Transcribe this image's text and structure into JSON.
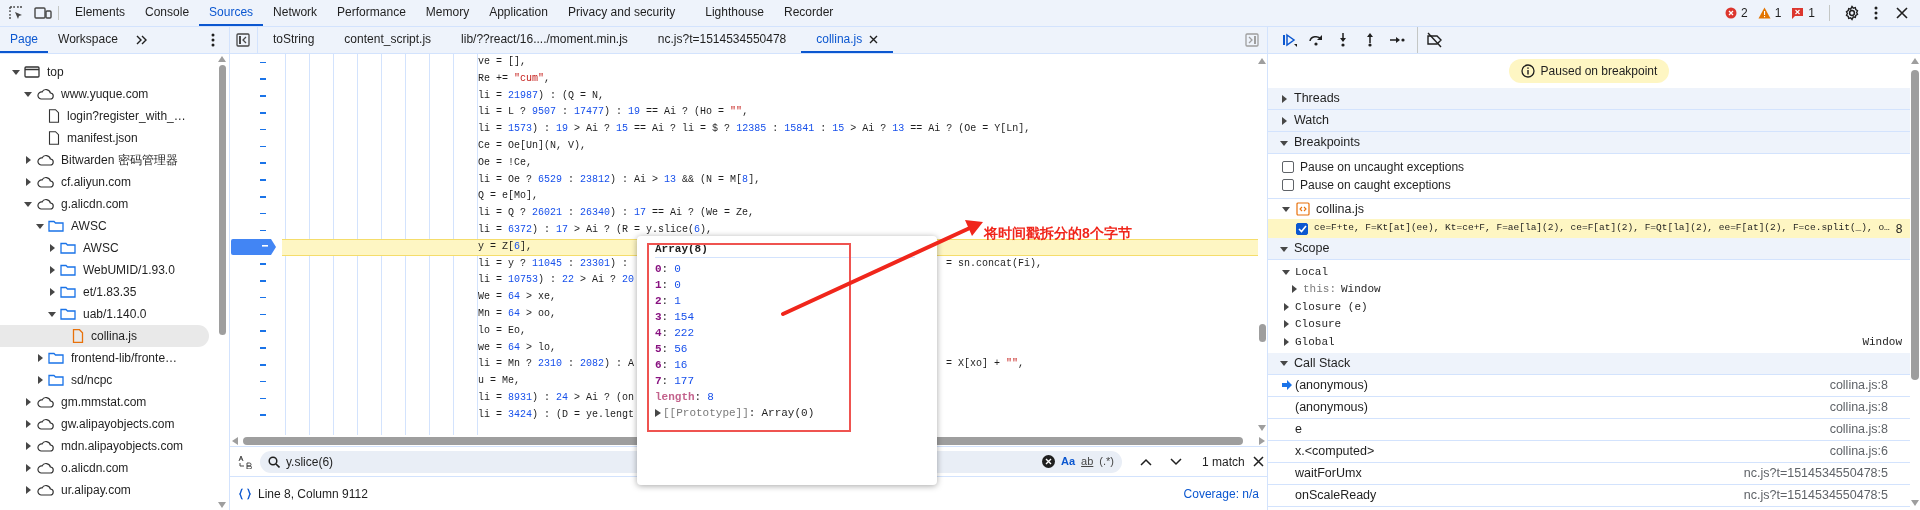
{
  "toolbar": {
    "tabs": [
      {
        "label": "Elements",
        "selected": false
      },
      {
        "label": "Console",
        "selected": false
      },
      {
        "label": "Sources",
        "selected": true
      },
      {
        "label": "Network",
        "selected": false
      },
      {
        "label": "Performance",
        "selected": false
      },
      {
        "label": "Memory",
        "selected": false
      },
      {
        "label": "Application",
        "selected": false
      },
      {
        "label": "Privacy and security",
        "selected": false
      },
      {
        "label": "Lighthouse",
        "selected": false
      },
      {
        "label": "Recorder",
        "selected": false
      }
    ],
    "counts": {
      "errors": "2",
      "warnings": "1",
      "issues": "1"
    }
  },
  "navigator": {
    "tabs": [
      {
        "label": "Page",
        "selected": true
      },
      {
        "label": "Workspace",
        "selected": false
      }
    ],
    "tree": [
      {
        "label": "top",
        "kind": "frame",
        "expanded": true,
        "selected": false,
        "children": [
          {
            "label": "www.yuque.com",
            "kind": "domain",
            "expanded": true,
            "selected": false,
            "children": [
              {
                "label": "login?register_with_…",
                "kind": "file",
                "selected": false
              },
              {
                "label": "manifest.json",
                "kind": "file",
                "selected": false
              }
            ]
          },
          {
            "label": "Bitwarden 密码管理器",
            "kind": "domain",
            "expanded": false,
            "selected": false
          },
          {
            "label": "cf.aliyun.com",
            "kind": "domain",
            "expanded": false,
            "selected": false
          },
          {
            "label": "g.alicdn.com",
            "kind": "domain",
            "expanded": true,
            "selected": false,
            "children": [
              {
                "label": "AWSC",
                "kind": "folder",
                "expanded": true,
                "selected": false,
                "children": [
                  {
                    "label": "AWSC",
                    "kind": "folder",
                    "expanded": false,
                    "selected": false
                  },
                  {
                    "label": "WebUMID/1.93.0",
                    "kind": "folder",
                    "expanded": false,
                    "selected": false
                  },
                  {
                    "label": "et/1.83.35",
                    "kind": "folder",
                    "expanded": false,
                    "selected": false
                  },
                  {
                    "label": "uab/1.140.0",
                    "kind": "folder",
                    "expanded": true,
                    "selected": false,
                    "children": [
                      {
                        "label": "collina.js",
                        "kind": "script",
                        "selected": true
                      }
                    ]
                  }
                ]
              },
              {
                "label": "frontend-lib/fronte…",
                "kind": "folder",
                "expanded": false,
                "selected": false
              },
              {
                "label": "sd/ncpc",
                "kind": "folder",
                "expanded": false,
                "selected": false
              }
            ]
          },
          {
            "label": "gm.mmstat.com",
            "kind": "domain",
            "expanded": false,
            "selected": false
          },
          {
            "label": "gw.alipayobjects.com",
            "kind": "domain",
            "expanded": false,
            "selected": false
          },
          {
            "label": "mdn.alipayobjects.com",
            "kind": "domain",
            "expanded": false,
            "selected": false
          },
          {
            "label": "o.alicdn.com",
            "kind": "domain",
            "expanded": false,
            "selected": false
          },
          {
            "label": "ur.alipay.com",
            "kind": "domain",
            "expanded": false,
            "selected": false
          }
        ]
      }
    ]
  },
  "editor": {
    "tabs": [
      {
        "label": "toString",
        "selected": false
      },
      {
        "label": "content_script.js",
        "selected": false
      },
      {
        "label": "lib/??react/16..../moment.min.js",
        "selected": false
      },
      {
        "label": "nc.js?t=1514534550478",
        "selected": false
      },
      {
        "label": "collina.js",
        "selected": true
      }
    ],
    "lines": [
      {
        "text": "ve = [],",
        "paused_here": false
      },
      {
        "text": "Re += \"cum\",",
        "paused_here": false
      },
      {
        "text": "li = 21987) : (Q = N,",
        "paused_here": false
      },
      {
        "text": "li = L ? 9507 : 17477) : 19 == Ai ? (Ho = \"\",",
        "paused_here": false
      },
      {
        "text": "li = 1573) : 19 > Ai ? 15 == Ai ? li = $ ? 12385 : 15841 : 15 > Ai ? 13 == Ai ? (Oe = Y[Ln],",
        "paused_here": false
      },
      {
        "text": "Ce = Oe[Un](N, V),",
        "paused_here": false
      },
      {
        "text": "Oe = !Ce,",
        "paused_here": false
      },
      {
        "text": "li = Oe ? 6529 : 23812) : Ai > 13 && (N = M[8],",
        "paused_here": false
      },
      {
        "text": "Q = e[Mo],",
        "paused_here": false
      },
      {
        "text": "li = Q ? 26021 : 26340) : 17 == Ai ? (We = Ze,",
        "paused_here": false
      },
      {
        "text": "li = 6372) : 17 > Ai ? (R = y.slice(6),",
        "paused_here": false
      },
      {
        "text": "y = Z[6],",
        "paused_here": true
      },
      {
        "text": "li = y ? 11045 : 23301) :",
        "tail": "= sn.concat(Fi),",
        "paused_here": false
      },
      {
        "text": "li = 10753) : 22 > Ai ? 20",
        "paused_here": false
      },
      {
        "text": "We = 64 > xe,",
        "paused_here": false
      },
      {
        "text": "Mn = 64 > oo,",
        "paused_here": false
      },
      {
        "text": "lo = Eo,",
        "paused_here": false
      },
      {
        "text": "we = 64 > lo,",
        "paused_here": false
      },
      {
        "text": "li = Mn ? 2310 : 2082) : A",
        "tail": "= X[xo] + \"\",",
        "paused_here": false
      },
      {
        "text": "u = Me,",
        "paused_here": false
      },
      {
        "text": "li = 8931) : 24 > Ai ? (on",
        "paused_here": false
      },
      {
        "text": "li = 3424) : (D = ye.lengt",
        "paused_here": false
      }
    ],
    "popover": {
      "title": "Array(8)",
      "separator": ":",
      "entries": [
        {
          "kind": "index",
          "key": "0",
          "value": "0"
        },
        {
          "kind": "index",
          "key": "1",
          "value": "0"
        },
        {
          "kind": "index",
          "key": "2",
          "value": "1"
        },
        {
          "kind": "index",
          "key": "3",
          "value": "154"
        },
        {
          "kind": "index",
          "key": "4",
          "value": "222"
        },
        {
          "kind": "index",
          "key": "5",
          "value": "56"
        },
        {
          "kind": "index",
          "key": "6",
          "value": "16"
        },
        {
          "kind": "index",
          "key": "7",
          "value": "177"
        },
        {
          "kind": "length",
          "key": "length",
          "value": "8"
        },
        {
          "kind": "prototype",
          "key": "[[Prototype]]",
          "value": "Array(0)"
        }
      ]
    },
    "annotation": {
      "text": "将时间戳拆分的8个字节"
    },
    "search": {
      "value": "y.slice(6)",
      "options": [
        {
          "kind": "case",
          "label": "Aa",
          "active": true
        },
        {
          "kind": "word",
          "label": "ab",
          "active": false
        },
        {
          "kind": "regex",
          "label": "(.*)",
          "active": false
        }
      ],
      "matches": "1 match"
    },
    "status_bar": {
      "position": "Line 8, Column 9112",
      "coverage": "Coverage: n/a"
    }
  },
  "debugger": {
    "banner": "Paused on breakpoint",
    "threads": {
      "title": "Threads",
      "expanded": false
    },
    "watch": {
      "title": "Watch",
      "expanded": false
    },
    "breakpoints": {
      "title": "Breakpoints",
      "expanded": true,
      "options": [
        {
          "label": "Pause on uncaught exceptions",
          "checked": false
        },
        {
          "label": "Pause on caught exceptions",
          "checked": false
        }
      ],
      "files": [
        {
          "name": "collina.js",
          "expanded": true,
          "items": [
            {
              "code": "ce=F+te, F=Kt[at](ee), Kt=ce+F, F=ae[la](2), ce=F[at](2), F=Qt[la](2), ee=F[at](2), F=ce.split(_), o…",
              "line": "8",
              "checked": true,
              "hit": true
            }
          ]
        }
      ]
    },
    "scope": {
      "title": "Scope",
      "expanded": true,
      "items": [
        {
          "label": "Local",
          "expanded": true,
          "children": [
            {
              "label": "this:",
              "value": "Window",
              "expanded": false
            }
          ]
        },
        {
          "label": "Closure (e)",
          "expanded": false
        },
        {
          "label": "Closure",
          "expanded": false
        },
        {
          "label": "Global",
          "value": "Window",
          "expanded": false
        }
      ]
    },
    "call_stack": {
      "title": "Call Stack",
      "expanded": true,
      "frames": [
        {
          "name": "(anonymous)",
          "location": "collina.js:8",
          "current": true
        },
        {
          "name": "(anonymous)",
          "location": "collina.js:8",
          "current": false
        },
        {
          "name": "e",
          "location": "collina.js:8",
          "current": false
        },
        {
          "name": "x.<computed>",
          "location": "collina.js:6",
          "current": false
        },
        {
          "name": "waitForUmx",
          "location": "nc.js?t=1514534550478:5",
          "current": false
        },
        {
          "name": "onScaleReady",
          "location": "nc.js?t=1514534550478:5",
          "current": false
        }
      ]
    }
  }
}
